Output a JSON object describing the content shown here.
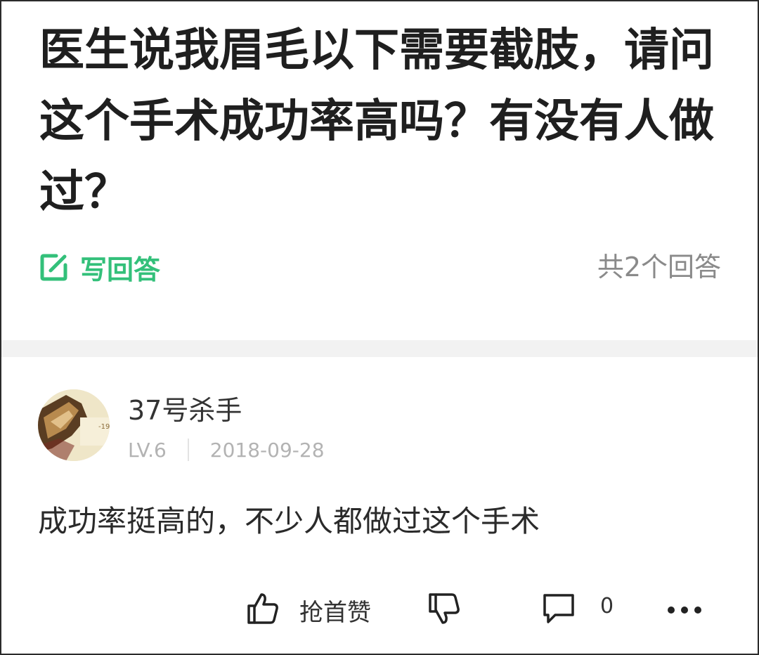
{
  "question": {
    "title": "医生说我眉毛以下需要截肢，请问这个手术成功率高吗？有没有人做过？"
  },
  "actions_bar": {
    "write_answer_label": "写回答",
    "answer_count_text": "共2个回答"
  },
  "answer": {
    "username": "37号杀手",
    "level": "LV.6",
    "date": "2018-09-28",
    "content": "成功率挺高的，不少人都做过这个手术",
    "like_label": "抢首赞",
    "comment_count": "0"
  },
  "colors": {
    "accent": "#33c07a",
    "muted": "#8a8a8a"
  },
  "icons": {
    "write": "edit-square-icon",
    "like": "thumbs-up-icon",
    "dislike": "thumbs-down-icon",
    "comment": "comment-bubble-icon",
    "more": "more-dots-icon"
  }
}
